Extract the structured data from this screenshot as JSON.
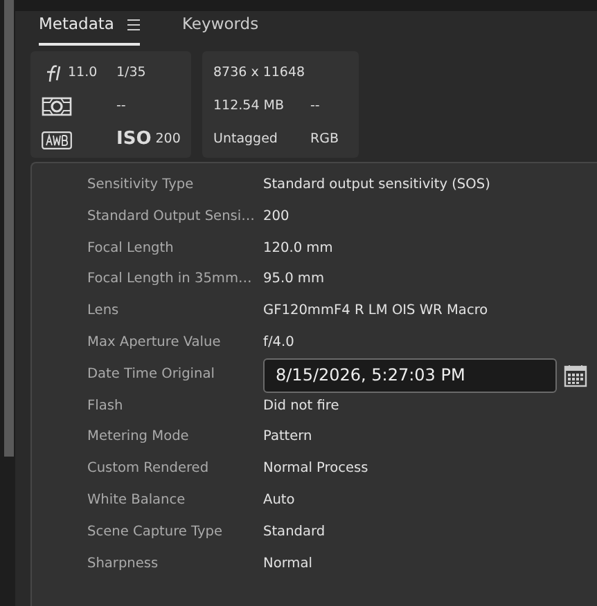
{
  "tabs": [
    {
      "label": "Metadata",
      "selected": true,
      "menu_icon": true
    },
    {
      "label": "Keywords",
      "selected": false,
      "menu_icon": false
    }
  ],
  "exposure": {
    "aperture": "11.0",
    "shutter": "1/35",
    "metering": "--",
    "iso_label": "ISO",
    "iso": "200"
  },
  "file_info": {
    "dimensions": "8736 x 11648",
    "size": "112.54 MB",
    "size_extra": "--",
    "color_profile": "Untagged",
    "color_mode": "RGB"
  },
  "fields": [
    {
      "kind": "text",
      "label": "Sensitivity Type",
      "value": "Standard output sensitivity (SOS)"
    },
    {
      "kind": "text",
      "label": "Standard Output Sensi…",
      "value": "200"
    },
    {
      "kind": "text",
      "label": "Focal Length",
      "value": "120.0 mm"
    },
    {
      "kind": "text",
      "label": "Focal Length in 35mm…",
      "value": "95.0 mm"
    },
    {
      "kind": "text",
      "label": "Lens",
      "value": "GF120mmF4 R LM OIS WR Macro"
    },
    {
      "kind": "text",
      "label": "Max Aperture Value",
      "value": "f/4.0"
    },
    {
      "kind": "date",
      "label": "Date Time Original",
      "value": "8/15/2026, 5:27:03 PM"
    },
    {
      "kind": "text",
      "label": "Flash",
      "value": "Did not fire"
    },
    {
      "kind": "text",
      "label": "Metering Mode",
      "value": "Pattern"
    },
    {
      "kind": "text",
      "label": "Custom Rendered",
      "value": "Normal Process"
    },
    {
      "kind": "text",
      "label": "White Balance",
      "value": "Auto"
    },
    {
      "kind": "text",
      "label": "Scene Capture Type",
      "value": "Standard"
    },
    {
      "kind": "text",
      "label": "Sharpness",
      "value": "Normal"
    }
  ]
}
